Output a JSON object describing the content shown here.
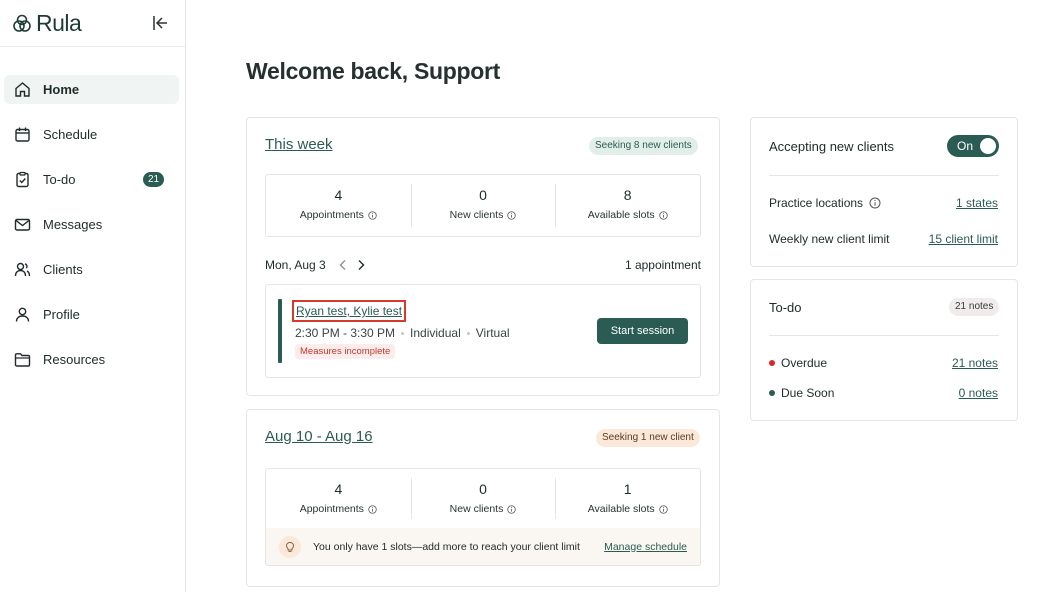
{
  "app": {
    "logo_text": "Rula"
  },
  "sidebar": {
    "items": [
      {
        "label": "Home",
        "icon": "home-icon",
        "active": true
      },
      {
        "label": "Schedule",
        "icon": "calendar-icon"
      },
      {
        "label": "To-do",
        "icon": "clipboard-check-icon",
        "badge": "21"
      },
      {
        "label": "Messages",
        "icon": "mail-icon"
      },
      {
        "label": "Clients",
        "icon": "users-icon"
      },
      {
        "label": "Profile",
        "icon": "user-icon"
      },
      {
        "label": "Resources",
        "icon": "folder-icon"
      }
    ]
  },
  "main": {
    "title": "Welcome back, Support"
  },
  "this_week": {
    "title": "This week",
    "pill": "Seeking 8 new clients",
    "stats": [
      {
        "value": "4",
        "label": "Appointments"
      },
      {
        "value": "0",
        "label": "New clients"
      },
      {
        "value": "8",
        "label": "Available slots"
      }
    ],
    "date": "Mon, Aug 3",
    "appointment_count": "1 appointment",
    "appointment": {
      "names": "Ryan test, Kylie test",
      "time": "2:30 PM - 3:30 PM",
      "type": "Individual",
      "mode": "Virtual",
      "warning": "Measures incomplete",
      "button": "Start session"
    }
  },
  "next_week": {
    "title": "Aug 10 - Aug 16",
    "pill": "Seeking 1 new client",
    "stats": [
      {
        "value": "4",
        "label": "Appointments"
      },
      {
        "value": "0",
        "label": "New clients"
      },
      {
        "value": "1",
        "label": "Available slots"
      }
    ],
    "hint": "You only have 1 slots—add more to reach your client limit",
    "hint_link": "Manage schedule"
  },
  "accepting": {
    "title": "Accepting new clients",
    "toggle_label": "On",
    "rows": [
      {
        "label": "Practice locations",
        "link": "1 states",
        "info": true
      },
      {
        "label": "Weekly new client limit",
        "link": "15 client limit",
        "info": false
      }
    ]
  },
  "todo": {
    "title": "To-do",
    "pill": "21 notes",
    "rows": [
      {
        "label": "Overdue",
        "link": "21 notes",
        "color": "#d62828"
      },
      {
        "label": "Due Soon",
        "link": "0 notes",
        "color": "#2b5c53"
      }
    ]
  },
  "colors": {
    "accent": "#2b5c53",
    "warning": "#c0392b",
    "highlight_box": "#d63a2c"
  }
}
